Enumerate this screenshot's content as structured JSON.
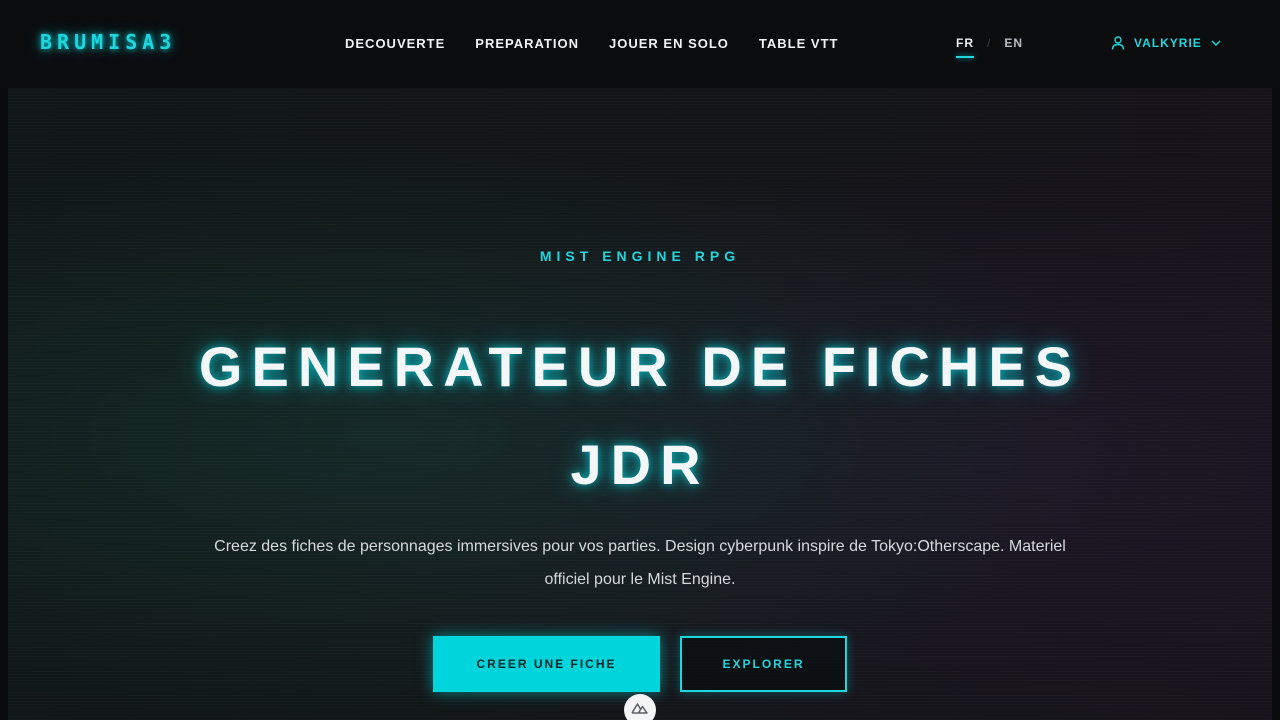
{
  "header": {
    "logo": "BRUMISA3",
    "nav": [
      "DECOUVERTE",
      "PREPARATION",
      "JOUER EN SOLO",
      "TABLE VTT"
    ],
    "languages": {
      "active": "FR",
      "separator": "/",
      "other": "EN"
    },
    "user": {
      "name": "VALKYRIE",
      "icon": "user-icon",
      "dropdown_icon": "chevron-down-icon"
    }
  },
  "hero": {
    "eyebrow": "MIST ENGINE RPG",
    "title_line1": "GENERATEUR DE FICHES",
    "title_line2": "JDR",
    "subtitle_line1": "Creez des fiches de personnages immersives pour vos parties. Design cyberpunk inspire de Tokyo:Otherscape. Materiel",
    "subtitle_line2": "officiel pour le Mist Engine.",
    "primary_button": "CREER UNE FICHE",
    "secondary_button": "EXPLORER",
    "floating_icon": "nuxt-logo-icon"
  },
  "colors": {
    "accent": "#1fd6dc",
    "background": "#0b0c0e",
    "primary_button_bg": "#00d5dc"
  }
}
